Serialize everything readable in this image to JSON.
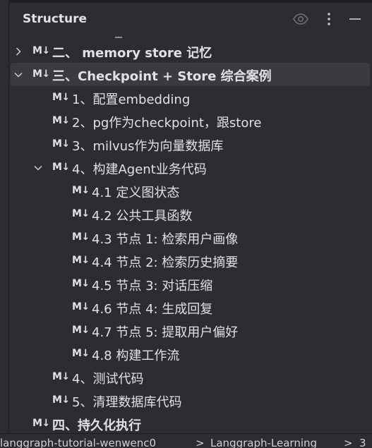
{
  "panel": {
    "title": "Structure"
  },
  "header_icons": [
    "eye-icon",
    "more-vertical-icon",
    "minimize-icon"
  ],
  "tree": [
    {
      "md": "M↓",
      "label": "二、 memory store 记忆",
      "bold": true,
      "chevron": "right",
      "selected": false
    },
    {
      "md": "M↓",
      "label": "三、Checkpoint + Store 综合案例",
      "bold": true,
      "chevron": "down",
      "selected": true
    },
    {
      "md": "M↓",
      "label": "1、配置embedding",
      "bold": false,
      "chevron": "",
      "selected": false
    },
    {
      "md": "M↓",
      "label": "2、pg作为checkpoint，跟store",
      "bold": false,
      "chevron": "",
      "selected": false
    },
    {
      "md": "M↓",
      "label": "3、milvus作为向量数据库",
      "bold": false,
      "chevron": "",
      "selected": false
    },
    {
      "md": "M↓",
      "label": "4、构建Agent业务代码",
      "bold": false,
      "chevron": "down",
      "selected": false
    },
    {
      "md": "M↓",
      "label": "4.1 定义图状态",
      "bold": false,
      "chevron": "",
      "selected": false
    },
    {
      "md": "M↓",
      "label": "4.2 公共工具函数",
      "bold": false,
      "chevron": "",
      "selected": false
    },
    {
      "md": "M↓",
      "label": "4.3 节点 1: 检索用户画像",
      "bold": false,
      "chevron": "",
      "selected": false
    },
    {
      "md": "M↓",
      "label": "4.4 节点 2: 检索历史摘要",
      "bold": false,
      "chevron": "",
      "selected": false
    },
    {
      "md": "M↓",
      "label": "4.5 节点 3: 对话压缩",
      "bold": false,
      "chevron": "",
      "selected": false
    },
    {
      "md": "M↓",
      "label": "4.6 节点 4: 生成回复",
      "bold": false,
      "chevron": "",
      "selected": false
    },
    {
      "md": "M↓",
      "label": "4.7 节点 5: 提取用户偏好",
      "bold": false,
      "chevron": "",
      "selected": false
    },
    {
      "md": "M↓",
      "label": "4.8 构建工作流",
      "bold": false,
      "chevron": "",
      "selected": false
    },
    {
      "md": "M↓",
      "label": "4、测试代码",
      "bold": false,
      "chevron": "",
      "selected": false
    },
    {
      "md": "M↓",
      "label": "5、清理数据库代码",
      "bold": false,
      "chevron": "",
      "selected": false
    },
    {
      "md": "M↓",
      "label": "四、持久化执行",
      "bold": true,
      "chevron": "",
      "selected": false
    }
  ],
  "breadcrumb": {
    "items": [
      "langgraph-tutorial-wenwenc0",
      "Langgraph-Learning",
      "3"
    ],
    "separator": ">"
  }
}
